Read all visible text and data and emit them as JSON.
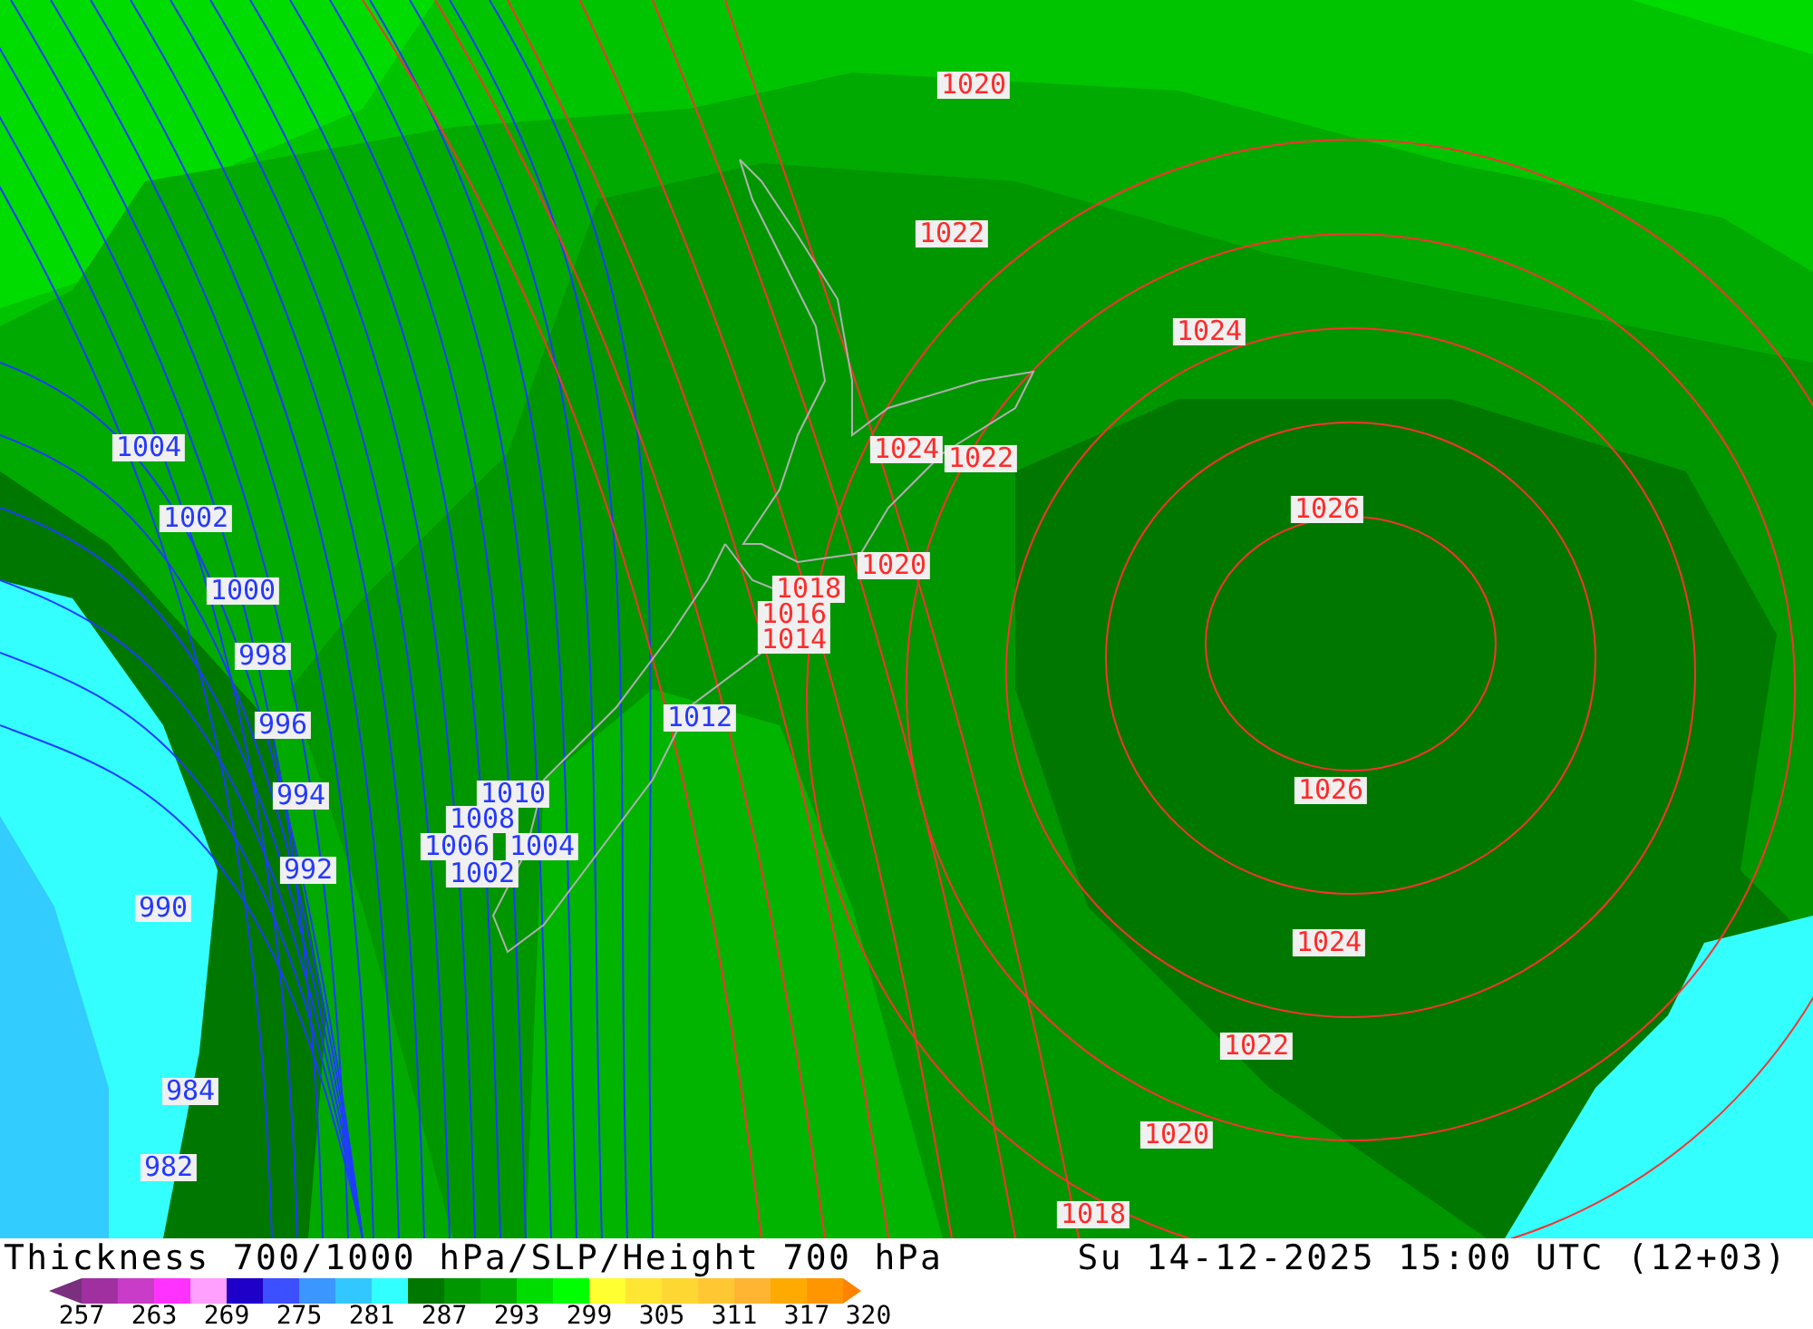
{
  "map": {
    "labels": [
      {
        "text": "1020",
        "kind": "high"
      },
      {
        "text": "1022",
        "kind": "high"
      },
      {
        "text": "1024",
        "kind": "high"
      },
      {
        "text": "1024",
        "kind": "high"
      },
      {
        "text": "1022",
        "kind": "high"
      },
      {
        "text": "1026",
        "kind": "high"
      },
      {
        "text": "1020",
        "kind": "high"
      },
      {
        "text": "1018",
        "kind": "high"
      },
      {
        "text": "1016",
        "kind": "high"
      },
      {
        "text": "1014",
        "kind": "high"
      },
      {
        "text": "1012",
        "kind": "low"
      },
      {
        "text": "1026",
        "kind": "high"
      },
      {
        "text": "1024",
        "kind": "high"
      },
      {
        "text": "1022",
        "kind": "high"
      },
      {
        "text": "1020",
        "kind": "high"
      },
      {
        "text": "1018",
        "kind": "high"
      },
      {
        "text": "1004",
        "kind": "low"
      },
      {
        "text": "1002",
        "kind": "low"
      },
      {
        "text": "1000",
        "kind": "low"
      },
      {
        "text": "998",
        "kind": "low"
      },
      {
        "text": "996",
        "kind": "low"
      },
      {
        "text": "994",
        "kind": "low"
      },
      {
        "text": "992",
        "kind": "low"
      },
      {
        "text": "990",
        "kind": "low"
      },
      {
        "text": "984",
        "kind": "low"
      },
      {
        "text": "982",
        "kind": "low"
      },
      {
        "text": "1010",
        "kind": "low"
      },
      {
        "text": "1008",
        "kind": "low"
      },
      {
        "text": "1006",
        "kind": "low"
      },
      {
        "text": "1004",
        "kind": "low"
      },
      {
        "text": "1002",
        "kind": "low"
      }
    ]
  },
  "footer": {
    "title": "Thickness 700/1000 hPa/SLP/Height 700 hPa",
    "time": "Su 14-12-2025 15:00 UTC (12+03)"
  },
  "legend": {
    "swatches": [
      {
        "kind": "arrow-left",
        "color": "#7a2f7f"
      },
      {
        "kind": "swatch",
        "color": "#a030a0"
      },
      {
        "kind": "swatch",
        "color": "#c83cc8"
      },
      {
        "kind": "swatch",
        "color": "#ff32ff"
      },
      {
        "kind": "swatch",
        "color": "#ffa0ff"
      },
      {
        "kind": "swatch",
        "color": "#1e00c8"
      },
      {
        "kind": "swatch",
        "color": "#3c50ff"
      },
      {
        "kind": "swatch",
        "color": "#3c96ff"
      },
      {
        "kind": "swatch",
        "color": "#32c8ff"
      },
      {
        "kind": "swatch",
        "color": "#32ffff"
      },
      {
        "kind": "swatch",
        "color": "#007800"
      },
      {
        "kind": "swatch",
        "color": "#009600"
      },
      {
        "kind": "swatch",
        "color": "#00aa00"
      },
      {
        "kind": "swatch",
        "color": "#00dc00"
      },
      {
        "kind": "swatch",
        "color": "#00ff00"
      },
      {
        "kind": "swatch",
        "color": "#ffff32"
      },
      {
        "kind": "swatch",
        "color": "#ffe632"
      },
      {
        "kind": "swatch",
        "color": "#ffd732"
      },
      {
        "kind": "swatch",
        "color": "#ffc832"
      },
      {
        "kind": "swatch",
        "color": "#ffb432"
      },
      {
        "kind": "swatch",
        "color": "#ffaa00"
      },
      {
        "kind": "swatch",
        "color": "#ff9600"
      },
      {
        "kind": "arrow-right",
        "color": "#ff8200"
      }
    ],
    "ticks": [
      "257",
      "263",
      "269",
      "275",
      "281",
      "287",
      "293",
      "299",
      "305",
      "311",
      "317",
      "320"
    ]
  }
}
